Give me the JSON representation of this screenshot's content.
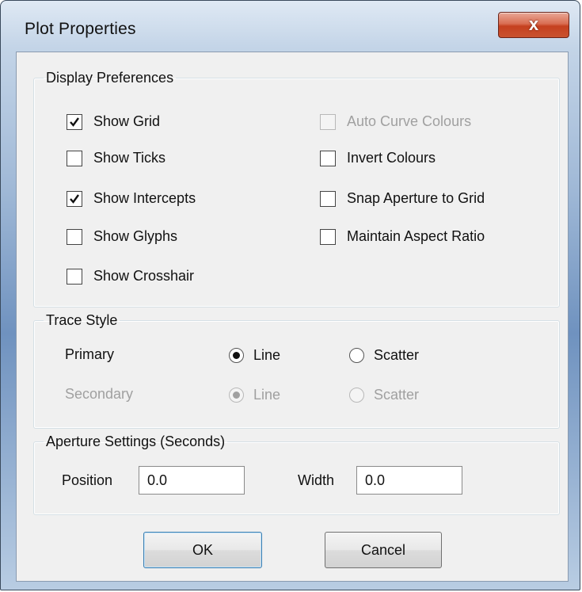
{
  "window": {
    "title": "Plot Properties",
    "close_glyph": "x"
  },
  "display_preferences": {
    "legend": "Display Preferences",
    "left_options": [
      {
        "label": "Show Grid",
        "checked": true,
        "enabled": true
      },
      {
        "label": "Show Ticks",
        "checked": false,
        "enabled": true
      },
      {
        "label": "Show Intercepts",
        "checked": true,
        "enabled": true
      },
      {
        "label": "Show Glyphs",
        "checked": false,
        "enabled": true
      },
      {
        "label": "Show Crosshair",
        "checked": false,
        "enabled": true
      }
    ],
    "right_options": [
      {
        "label": "Auto Curve Colours",
        "checked": false,
        "enabled": false
      },
      {
        "label": "Invert Colours",
        "checked": false,
        "enabled": true
      },
      {
        "label": "Snap Aperture to Grid",
        "checked": false,
        "enabled": true
      },
      {
        "label": "Maintain Aspect Ratio",
        "checked": false,
        "enabled": true
      }
    ]
  },
  "trace_style": {
    "legend": "Trace Style",
    "primary": {
      "label": "Primary",
      "options": [
        "Line",
        "Scatter"
      ],
      "selected": "Line",
      "enabled": true
    },
    "secondary": {
      "label": "Secondary",
      "options": [
        "Line",
        "Scatter"
      ],
      "selected": "Line",
      "enabled": false
    }
  },
  "aperture": {
    "legend": "Aperture Settings (Seconds)",
    "position_label": "Position",
    "position_value": "0.0",
    "width_label": "Width",
    "width_value": "0.0"
  },
  "buttons": {
    "ok": "OK",
    "cancel": "Cancel"
  }
}
